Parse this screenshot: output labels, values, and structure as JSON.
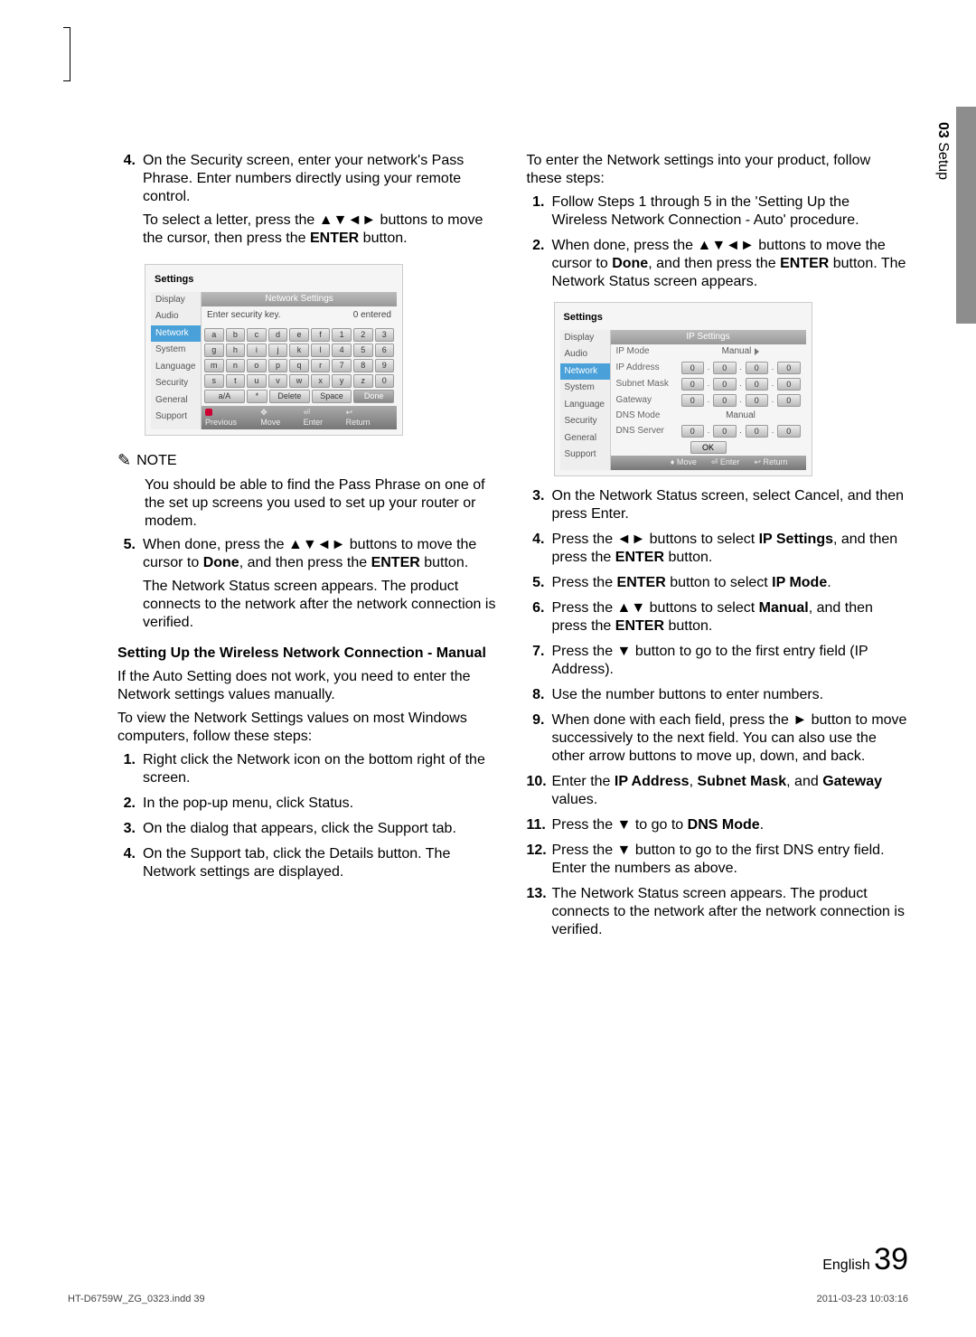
{
  "side_tab": {
    "chapter_num": "03",
    "chapter_name": "Setup"
  },
  "left": {
    "step4": {
      "num": "4.",
      "p1": "On the Security screen, enter your network's Pass Phrase. Enter numbers directly using your remote control.",
      "p2_pre": "To select a letter, press the ▲▼◄► buttons to move the cursor, then press the ",
      "p2_b": "ENTER",
      "p2_post": " button."
    },
    "note": {
      "label": "NOTE",
      "body": "You should be able to find the Pass Phrase on one of the set up screens you used to set up your router or modem."
    },
    "step5": {
      "num": "5.",
      "p1_pre": "When done, press the ▲▼◄► buttons to move the cursor to ",
      "p1_b1": "Done",
      "p1_mid": ", and then press the ",
      "p1_b2": "ENTER",
      "p1_post": " button.",
      "p2": "The Network Status screen appears. The product connects to the network after the network connection is verified."
    },
    "hdr": "Setting Up the Wireless Network Connection - Manual",
    "para1": "If the Auto Setting does not work, you need to enter the Network settings values manually.",
    "para2": "To view the Network Settings values on most Windows computers, follow these steps:",
    "w1": {
      "num": "1.",
      "t": "Right click the Network icon on the bottom right of the screen."
    },
    "w2": {
      "num": "2.",
      "t": "In the pop-up menu, click Status."
    },
    "w3": {
      "num": "3.",
      "t": "On the dialog that appears, click the Support tab."
    },
    "w4": {
      "num": "4.",
      "t": "On the Support tab, click the Details button. The Network settings are displayed."
    }
  },
  "right": {
    "intro": "To enter the Network settings into your product, follow these steps:",
    "s1": {
      "num": "1.",
      "t": "Follow Steps 1 through 5 in the 'Setting Up the Wireless Network Connection - Auto' procedure."
    },
    "s2": {
      "num": "2.",
      "pre": "When done, press the ▲▼◄► buttons to move the cursor to ",
      "b1": "Done",
      "mid": ", and then press the ",
      "b2": "ENTER",
      "post": " button. The Network Status screen appears."
    },
    "s3": {
      "num": "3.",
      "t": "On the Network Status screen, select Cancel, and then press Enter."
    },
    "s4": {
      "num": "4.",
      "pre": "Press the ◄► buttons to select ",
      "b1": "IP Settings",
      "mid": ", and then press the ",
      "b2": "ENTER",
      "post": " button."
    },
    "s5": {
      "num": "5.",
      "pre": "Press the ",
      "b1": "ENTER",
      "mid": " button to select ",
      "b2": "IP Mode",
      "post": "."
    },
    "s6": {
      "num": "6.",
      "pre": "Press the ▲▼ buttons to select ",
      "b1": "Manual",
      "mid": ", and then press the ",
      "b2": "ENTER",
      "post": " button."
    },
    "s7": {
      "num": "7.",
      "t": "Press the ▼ button to go to the first entry field (IP Address)."
    },
    "s8": {
      "num": "8.",
      "t": "Use the number buttons to enter numbers."
    },
    "s9": {
      "num": "9.",
      "t": "When done with each field, press the ► button to move successively to the next field. You can also use the other arrow buttons to move up, down, and back."
    },
    "s10": {
      "num": "10.",
      "pre": "Enter the ",
      "b1": "IP Address",
      "mid1": ", ",
      "b2": "Subnet Mask",
      "mid2": ", and ",
      "b3": "Gateway",
      "post": " values."
    },
    "s11": {
      "num": "11.",
      "pre": "Press the ▼ to go to ",
      "b1": "DNS Mode",
      "post": "."
    },
    "s12": {
      "num": "12.",
      "t": "Press the ▼ button to go to the first DNS entry field. Enter the numbers as above."
    },
    "s13": {
      "num": "13.",
      "t": "The Network Status screen appears. The product connects to the network after the network connection is verified."
    }
  },
  "ui1": {
    "title": "Settings",
    "bar": "Network Settings",
    "prompt": "Enter security key.",
    "entered": "0 entered",
    "side": [
      "Display",
      "Audio",
      "Network",
      "System",
      "Language",
      "Security",
      "General",
      "Support"
    ],
    "kbd": {
      "r1": [
        "a",
        "b",
        "c",
        "d",
        "e",
        "f",
        "1",
        "2",
        "3"
      ],
      "r2": [
        "g",
        "h",
        "i",
        "j",
        "k",
        "l",
        "4",
        "5",
        "6"
      ],
      "r3": [
        "m",
        "n",
        "o",
        "p",
        "q",
        "r",
        "7",
        "8",
        "9"
      ],
      "r4": [
        "s",
        "t",
        "u",
        "v",
        "w",
        "x",
        "y",
        "z",
        "0"
      ],
      "r5": [
        "a/A",
        "*",
        "Delete",
        "Space",
        "Done"
      ]
    },
    "foot": {
      "prev": "Previous",
      "move": "Move",
      "enter": "Enter",
      "ret": "Return"
    }
  },
  "ui2": {
    "title": "Settings",
    "bar": "IP Settings",
    "side": [
      "Display",
      "Audio",
      "Network",
      "System",
      "Language",
      "Security",
      "General",
      "Support"
    ],
    "rows": {
      "ipmode": {
        "lbl": "IP Mode",
        "val": "Manual"
      },
      "ipaddr": "IP Address",
      "subnet": "Subnet Mask",
      "gateway": "Gateway",
      "dnsmode": {
        "lbl": "DNS Mode",
        "val": "Manual"
      },
      "dnssrv": "DNS Server",
      "ok": "OK",
      "zero": "0"
    },
    "foot": {
      "move": "Move",
      "enter": "Enter",
      "ret": "Return"
    }
  },
  "page_foot": {
    "lang": "English",
    "num": "39"
  },
  "imprint": {
    "file": "HT-D6759W_ZG_0323.indd   39",
    "ts": "2011-03-23   10:03:16"
  }
}
